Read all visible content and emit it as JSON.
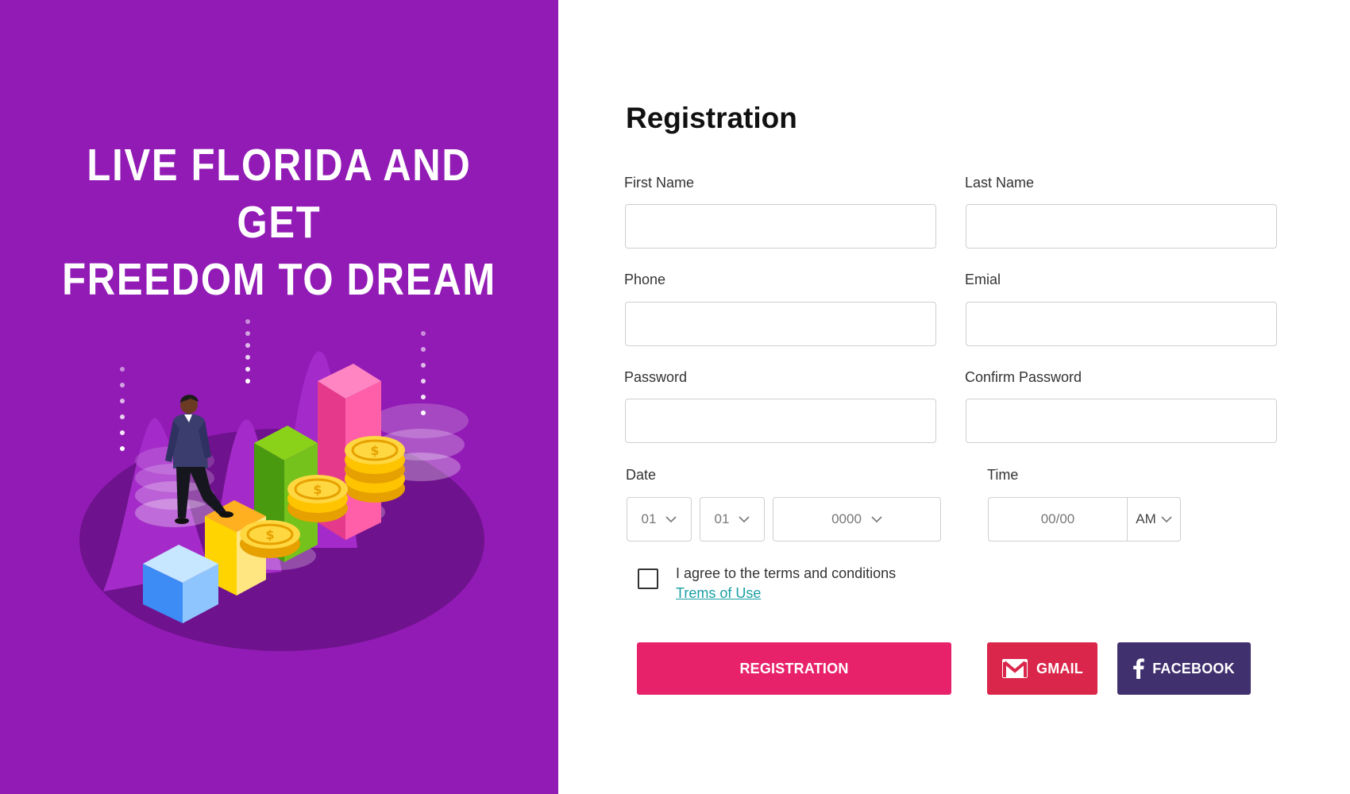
{
  "hero": {
    "headline_line1": "LIVE FLORIDA AND GET",
    "headline_line2": "FREEDOM TO DREAM",
    "background_color": "#921bb5"
  },
  "form": {
    "title": "Registration",
    "fields": {
      "first_name_label": "First Name",
      "last_name_label": "Last Name",
      "phone_label": "Phone",
      "email_label": "Emial",
      "password_label": "Password",
      "confirm_password_label": "Confirm Password",
      "date_label": "Date",
      "time_label": "Time"
    },
    "date": {
      "day": "01",
      "month": "01",
      "year": "0000"
    },
    "time": {
      "placeholder": "00/00",
      "period": "AM"
    },
    "agree_text": "I agree to the terms and conditions",
    "terms_link": "Trems of Use",
    "buttons": {
      "register": "REGISTRATION",
      "gmail": "GMAIL",
      "facebook": "FACEBOOK"
    },
    "colors": {
      "register": "#e8226a",
      "gmail": "#d9264a",
      "facebook": "#40306e",
      "link": "#1a9fa4"
    }
  }
}
